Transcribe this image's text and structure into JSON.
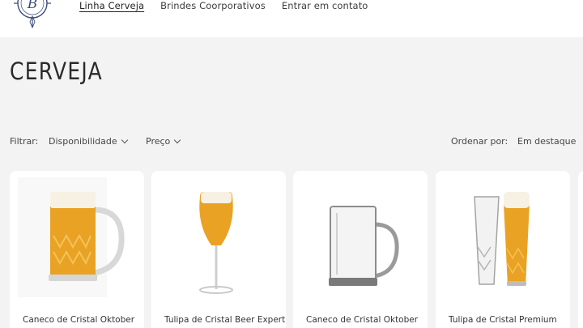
{
  "header": {
    "logo_alt": "B logo",
    "nav": [
      {
        "label": "Linha Cerveja",
        "active": true
      },
      {
        "label": "Brindes Coorporativos",
        "active": false
      },
      {
        "label": "Entrar em contato",
        "active": false
      }
    ]
  },
  "page": {
    "title": "CERVEJA"
  },
  "filters": {
    "label": "Filtrar:",
    "availability": "Disponibilidade",
    "price": "Preço",
    "sort_label": "Ordenar por:",
    "sort_value": "Em destaque"
  },
  "products": [
    {
      "title": "Caneco de Cristal Oktober",
      "image": "beer-mug-filled"
    },
    {
      "title": "Tulipa de Cristal Beer Expert",
      "image": "tulip-glass-filled"
    },
    {
      "title": "Caneco de Cristal Oktober",
      "image": "beer-mug-empty"
    },
    {
      "title": "Tulipa de Cristal Premium",
      "image": "tall-glasses-pair"
    }
  ],
  "colors": {
    "background": "#f3f3f3",
    "header_bg": "#ffffff",
    "beer": "#e9a224",
    "foam": "#f7f1e4",
    "logo_navy": "#3a4a7a"
  }
}
